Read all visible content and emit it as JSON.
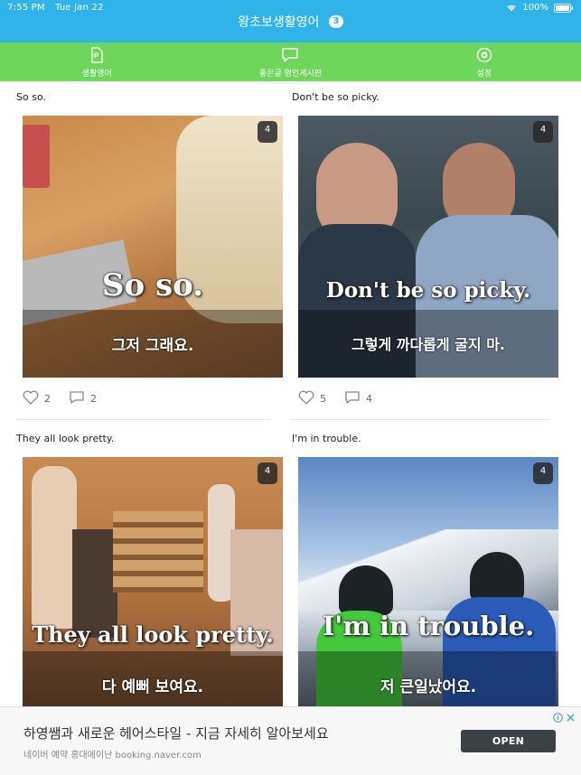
{
  "status_bar": {
    "time": "7:55 PM",
    "date": "Tue Jan 22",
    "battery": "100%"
  },
  "header": {
    "title": "왕초보생활영어",
    "badge": "3"
  },
  "tabs": [
    {
      "label": "생활영어",
      "icon": "document-icon"
    },
    {
      "label": "좋은글 명언게시판",
      "icon": "chat-bubble-icon"
    },
    {
      "label": "설정",
      "icon": "gear-icon"
    }
  ],
  "cards": [
    {
      "caption": "So so.",
      "count": "4",
      "image_en": "So so.",
      "image_ko": "그저 그래요.",
      "likes": "2",
      "comments": "2"
    },
    {
      "caption": "Don't be so picky.",
      "count": "4",
      "image_en": "Don't be so picky.",
      "image_ko": "그렇게 까다롭게 굴지 마.",
      "likes": "5",
      "comments": "4"
    },
    {
      "caption": "They all look pretty.",
      "count": "4",
      "image_en": "They all look pretty.",
      "image_ko": "다 예뻐 보여요."
    },
    {
      "caption": "I'm in trouble.",
      "count": "4",
      "image_en": "I'm in trouble.",
      "image_ko": "저 큰일났어요."
    }
  ],
  "ad": {
    "headline": "하영쌤과 새로운 헤어스타일 - 지금 자세히 알아보세요",
    "sub": "네이버 예약 홍대에이난 booking.naver.com",
    "open_label": "OPEN"
  },
  "colors": {
    "header": "#2fb3e8",
    "tab_bar": "#6ed65a"
  }
}
